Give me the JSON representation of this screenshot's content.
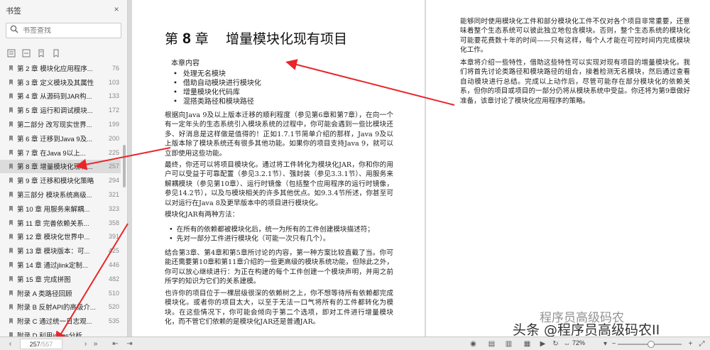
{
  "sidebar": {
    "title": "书签",
    "close_glyph": "×",
    "search_placeholder": "书签查找",
    "tools": [
      "expand-all-icon",
      "collapse-all-icon",
      "bookmark-delete-icon",
      "bookmark-add-icon"
    ],
    "items": [
      {
        "label": "第 2 章   模块化应用程序...",
        "page": "76"
      },
      {
        "label": "第 3 章   定义模块及其属性",
        "page": "103"
      },
      {
        "label": "第 4 章   从源码到JAR构...",
        "page": "133"
      },
      {
        "label": "第 5 章   运行和调试模块...",
        "page": "172"
      },
      {
        "label": "第二部分   改写现实世界...",
        "page": "199"
      },
      {
        "label": "第 6 章   迁移到Java 9及...",
        "page": "200"
      },
      {
        "label": "第 7 章   在Java 9以上...",
        "page": "225"
      },
      {
        "label": "第 8 章   增量模块化现有...",
        "page": "257",
        "active": true
      },
      {
        "label": "第 9 章   迁移和模块化策略",
        "page": "294"
      },
      {
        "label": "第三部分   模块系统高级...",
        "page": "321"
      },
      {
        "label": "第 10 章   用服务来解耦...",
        "page": "323"
      },
      {
        "label": "第 11 章   完善依赖关系...",
        "page": "358"
      },
      {
        "label": "第 12 章   模块化世界中...",
        "page": "391"
      },
      {
        "label": "第 13 章   模块版本：可...",
        "page": "425"
      },
      {
        "label": "第 14 章   通过jlink定制...",
        "page": "446"
      },
      {
        "label": "第 15 章   完成拼图",
        "page": "482"
      },
      {
        "label": "附录 A   类路径回顾",
        "page": "510"
      },
      {
        "label": "附录 B   反射API的高级介...",
        "page": "520"
      },
      {
        "label": "附录 C   通过统一日志观...",
        "page": "535"
      },
      {
        "label": "附录 D   利用jdeps分析...",
        "page": ""
      }
    ]
  },
  "left_page": {
    "chapter_prefix": "第",
    "chapter_number": "8",
    "chapter_suffix": "章",
    "chapter_title": "增量模块化现有项目",
    "contents_heading": "本章内容",
    "contents": [
      "处理无名模块",
      "借助自动模块进行模块化",
      "增量模块化代码库",
      "混搭类路径和模块路径"
    ],
    "p1": "根据向Java 9及以上版本迁移的顺利程度（参见第6章和第7章），在向一个有一定年头的生态系统引入模块系统的过程中，你可能会遇到一些比模块还多、好消息是这样做是值得的！正如1.7.1节简单介绍的那样，Java 9及以上版本除了模块系统还有很多其他功能。如果你的项目支持Java 9，就可以立即使用这些功能。",
    "p2": "最终，你还可以将项目模块化。通过将工件转化为模块化JAR，你和你的用户可以受益于可靠配置（参见3.2.1节）、强封装（参见3.3.1节）、用服务来解耦模块（参见第10章）、运行时镜像（包括整个应用程序的运行时镜像，参见14.2节），以及与模块相关的许多其他优点。如9.3.4节所述，你甚至可以对运行在Java 8及更早版本中的项目进行模块化。",
    "p3": "模块化JAR有两种方法：",
    "bullets": [
      "在所有的依赖都被模块化后，统一为所有的工件创建模块描述符；",
      "先对一部分工件进行模块化（可能一次只有几个）。"
    ],
    "p4": "结合第3章、第4章和第5章所讨论的内容，第一种方案比较直截了当。你可能还需要第10章和第11章介绍的一些更高级的模块系统功能，但除此之外，你可以放心继续进行：为正在构建的每个工件创建一个模块声明，并用之前所学的知识为它们的关系建模。",
    "p5": "也许你的项目位于一棵层级很深的依赖树之上，你不想等待所有依赖都完成模块化。或者你的项目太大，以至于无法一口气将所有的工件都转化为模块。在这些情况下，你可能会倾向于第二个选项，即对工件进行增量模块化，而不管它们依赖的是模块化JAR还是普通JAR。"
  },
  "right_page": {
    "p1": "能够同时使用模块化工件和部分模块化工件不仅对各个项目非常重要，还意味着整个生态系统可以彼此独立地包含模块。否则，整个生态系统的模块化可能要花费数十年的时间——只有这样，每个人才能在可控时间内完成模块化工作。",
    "p2": "本章将介绍一些特性，借助这些特性可以实现对现有项目的增量模块化。我们将首先讨论类路径和模块路径的组合，接着检测无名模块，然后通过查看自动模块进行总结。完成以上动作后，尽管可能存在部分模块化的依赖关系，但你的项目或项目的一部分仍将从模块系统中受益。你还将为第9章做好准备，该章讨论了模块化应用程序的策略。"
  },
  "bottombar": {
    "current_page": "257",
    "total_pages": "/557",
    "zoom": "72%"
  },
  "watermark": {
    "line1": "程序员高级码农",
    "line2": "头条 @程序员高级码农II"
  },
  "colors": {
    "annotation_arrow": "#e8262b",
    "active_item_bg": "#dcdcdc"
  }
}
